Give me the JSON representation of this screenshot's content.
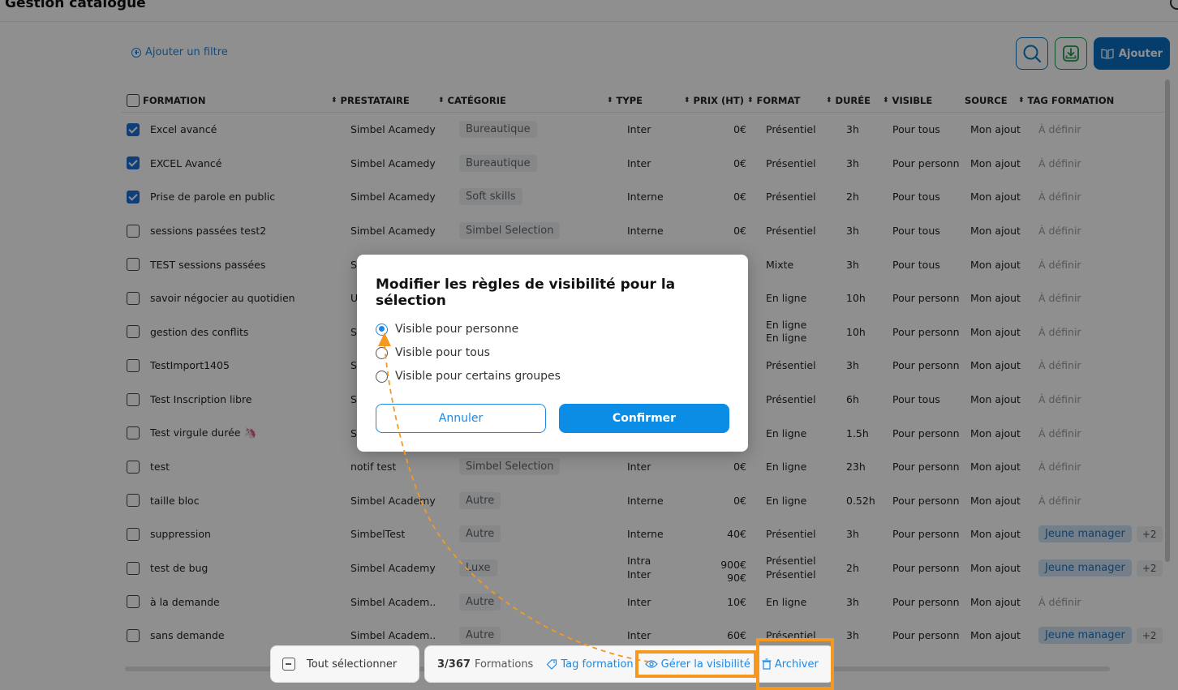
{
  "page": {
    "title": "Gestion catalogue"
  },
  "toolbar": {
    "add_filter_label": "Ajouter un filtre",
    "add_label": "Ajouter"
  },
  "table": {
    "columns": {
      "formation": "FORMATION",
      "prestataire": "PRESTATAIRE",
      "categorie": "CATÉGORIE",
      "type": "TYPE",
      "prix": "PRIX (HT)",
      "format": "FORMAT",
      "duree": "DURÉE",
      "visible": "VISIBLE",
      "source": "SOURCE",
      "tag": "TAG FORMATION"
    },
    "rows": [
      {
        "checked": true,
        "formation": "Excel avancé",
        "prestataire": "Simbel Acamedy",
        "categorie": "Bureautique",
        "type": "Inter",
        "prix": "0€",
        "format": "Présentiel",
        "duree": "3h",
        "visible": "Pour tous",
        "source": "Mon ajout",
        "tag": "À définir"
      },
      {
        "checked": true,
        "formation": "EXCEL Avancé",
        "prestataire": "Simbel Acamedy",
        "categorie": "Bureautique",
        "type": "Inter",
        "prix": "0€",
        "format": "Présentiel",
        "duree": "3h",
        "visible": "Pour personn",
        "source": "Mon ajout",
        "tag": "À définir"
      },
      {
        "checked": true,
        "formation": "Prise de parole en public",
        "prestataire": "Simbel Acamedy",
        "categorie": "Soft skills",
        "type": "Interne",
        "prix": "0€",
        "format": "Présentiel",
        "duree": "2h",
        "visible": "Pour tous",
        "source": "Mon ajout",
        "tag": "À définir"
      },
      {
        "checked": false,
        "formation": "sessions passées test2",
        "prestataire": "Simbel Acamedy",
        "categorie": "Simbel Selection",
        "type": "Interne",
        "prix": "0€",
        "format": "Présentiel",
        "duree": "3h",
        "visible": "Pour tous",
        "source": "Mon ajout",
        "tag": "À définir"
      },
      {
        "checked": false,
        "formation": "TEST sessions passées",
        "prestataire": "S",
        "categorie": "",
        "type": "",
        "prix": "",
        "format": "Mixte",
        "duree": "3h",
        "visible": "Pour tous",
        "source": "Mon ajout",
        "tag": "À définir"
      },
      {
        "checked": false,
        "formation": "savoir négocier au quotidien",
        "prestataire": "U",
        "categorie": "",
        "type": "",
        "prix": "",
        "format": "En ligne",
        "duree": "10h",
        "visible": "Pour personn",
        "source": "Mon ajout",
        "tag": "À définir"
      },
      {
        "checked": false,
        "formation": "gestion des conflits",
        "prestataire": "S",
        "categorie": "",
        "type": "",
        "prix": "",
        "format": "En ligne",
        "format2": "En ligne",
        "duree": "10h",
        "visible": "Pour personn",
        "source": "Mon ajout",
        "tag": "À définir"
      },
      {
        "checked": false,
        "formation": "TestImport1405",
        "prestataire": "S",
        "categorie": "",
        "type": "",
        "prix": "",
        "format": "Présentiel",
        "duree": "3h",
        "visible": "Pour personn",
        "source": "Mon ajout",
        "tag": "À définir"
      },
      {
        "checked": false,
        "formation": "Test Inscription libre",
        "prestataire": "S",
        "categorie": "",
        "type": "",
        "prix": "",
        "format": "Présentiel",
        "duree": "6h",
        "visible": "Pour tous",
        "source": "Mon ajout",
        "tag": "À définir"
      },
      {
        "checked": false,
        "formation": "Test virgule durée 🦄",
        "prestataire": "S",
        "categorie": "",
        "type": "",
        "prix": "",
        "format": "En ligne",
        "duree": "1.5h",
        "visible": "Pour personn",
        "source": "Mon ajout",
        "tag": "À définir"
      },
      {
        "checked": false,
        "formation": "test",
        "prestataire": "notif test",
        "categorie": "Simbel Selection",
        "type": "Inter",
        "prix": "0€",
        "format": "En ligne",
        "duree": "23h",
        "visible": "Pour personn",
        "source": "Mon ajout",
        "tag": "À définir"
      },
      {
        "checked": false,
        "formation": "taille bloc",
        "prestataire": "Simbel Academy",
        "categorie": "Autre",
        "type": "Interne",
        "prix": "0€",
        "format": "En ligne",
        "duree": "0.52h",
        "visible": "Pour personn",
        "source": "Mon ajout",
        "tag": "À définir"
      },
      {
        "checked": false,
        "formation": "suppression",
        "prestataire": "SimbelTest",
        "categorie": "Autre",
        "type": "Interne",
        "prix": "40€",
        "format": "Présentiel",
        "duree": "3h",
        "visible": "Pour personn",
        "source": "Mon ajout",
        "tag": "Jeune manager",
        "tag_extra": "+2"
      },
      {
        "checked": false,
        "formation": "test de bug",
        "prestataire": "Simbel Academy",
        "categorie": "Luxe",
        "type": "Intra",
        "type2": "Inter",
        "prix": "900€",
        "prix2": "90€",
        "format": "Présentiel",
        "format2": "Présentiel",
        "duree": "2h",
        "visible": "Pour personn",
        "source": "Mon ajout",
        "tag": "Jeune manager",
        "tag_extra": "+2"
      },
      {
        "checked": false,
        "formation": "à la demande",
        "prestataire": "Simbel Academ...",
        "categorie": "Autre",
        "type": "Inter",
        "prix": "10€",
        "format": "En ligne",
        "duree": "3h",
        "visible": "Pour personn",
        "source": "Mon ajout",
        "tag": "À définir"
      },
      {
        "checked": false,
        "formation": "sans demande",
        "prestataire": "Simbel Academ...",
        "categorie": "Autre",
        "type": "Inter",
        "prix": "60€",
        "format": "Présentiel",
        "duree": "3h",
        "visible": "Pour personn",
        "source": "Mon ajout",
        "tag": "Jeune manager",
        "tag_extra": "+2"
      }
    ]
  },
  "bottom_bar": {
    "select_all_label": "Tout sélectionner",
    "count": "3/367",
    "count_label": "Formations",
    "tag_label": "Tag formation",
    "visibility_label": "Gérer la visibilité",
    "archive_label": "Archiver"
  },
  "modal": {
    "title": "Modifier les règles de visibilité pour la sélection",
    "options": [
      {
        "label": "Visible pour personne",
        "selected": true
      },
      {
        "label": "Visible pour tous",
        "selected": false
      },
      {
        "label": "Visible pour certains groupes",
        "selected": false
      }
    ],
    "cancel_label": "Annuler",
    "confirm_label": "Confirmer"
  },
  "colors": {
    "accent": "#1e88e5",
    "primary_button": "#0a6fc2",
    "highlight": "#f5981f",
    "tag_chip_bg": "#cfe3f5",
    "category_chip_bg": "#eef0f3"
  }
}
